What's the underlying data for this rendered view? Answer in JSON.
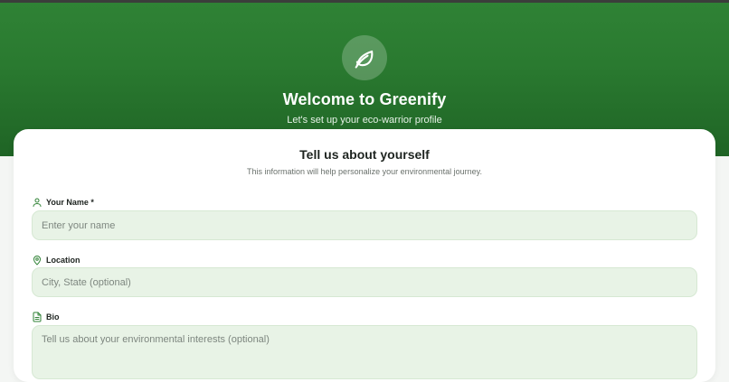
{
  "header": {
    "app_name": "Welcome to Greenify",
    "subtitle": "Let's set up your eco-warrior profile",
    "logo_icon": "leaf-icon"
  },
  "card": {
    "title": "Tell us about yourself",
    "subtitle": "This information will help personalize your environmental journey.",
    "fields": [
      {
        "label": "Your Name *",
        "icon": "user-icon",
        "value": "",
        "placeholder": "Enter your name"
      },
      {
        "label": "Location",
        "icon": "map-pin-icon",
        "value": "",
        "placeholder": "City, State (optional)"
      },
      {
        "label": "Bio",
        "icon": "document-icon",
        "value": "",
        "placeholder": "Tell us about your environmental interests (optional)"
      }
    ]
  },
  "colors": {
    "brand_green": "#2a7a30",
    "input_background": "#e8f3e6",
    "icon_green": "#2f8235"
  }
}
